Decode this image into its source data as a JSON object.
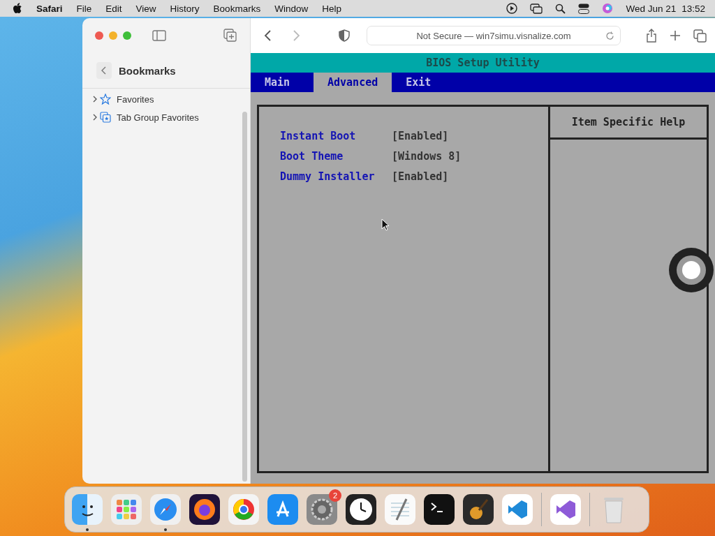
{
  "menu_bar": {
    "app": "Safari",
    "items": [
      "File",
      "Edit",
      "View",
      "History",
      "Bookmarks",
      "Window",
      "Help"
    ],
    "date": "Wed Jun 21",
    "time": "13:52"
  },
  "sidebar": {
    "title": "Bookmarks",
    "items": [
      {
        "label": "Favorites",
        "kind": "star",
        "expanded": false
      },
      {
        "label": "Tab Group Favorites",
        "kind": "tabgroup",
        "expanded": false
      }
    ]
  },
  "address_bar": {
    "text": "Not Secure — win7simu.visnalize.com"
  },
  "bios": {
    "title": "BIOS Setup Utility",
    "tabs": [
      {
        "label": "Main",
        "selected": false
      },
      {
        "label": "Advanced",
        "selected": true
      },
      {
        "label": "Exit",
        "selected": false
      }
    ],
    "settings": [
      {
        "label": "Instant Boot",
        "value": "[Enabled]"
      },
      {
        "label": "Boot Theme",
        "value": "[Windows 8]"
      },
      {
        "label": "Dummy Installer",
        "value": "[Enabled]"
      }
    ],
    "help_title": "Item Specific Help"
  },
  "dock": [
    {
      "kind": "finder",
      "running": true
    },
    {
      "kind": "launchpad",
      "running": false
    },
    {
      "kind": "safari",
      "running": true
    },
    {
      "kind": "firefox",
      "running": false
    },
    {
      "kind": "chrome",
      "running": false
    },
    {
      "kind": "appstore",
      "running": false
    },
    {
      "kind": "settings",
      "running": false,
      "badge": "2"
    },
    {
      "kind": "clock",
      "running": false
    },
    {
      "kind": "textedit",
      "running": false
    },
    {
      "kind": "terminal",
      "running": false
    },
    {
      "kind": "garageband",
      "running": false
    },
    {
      "kind": "vscode",
      "running": false
    },
    {
      "kind": "separator"
    },
    {
      "kind": "visualstudio",
      "running": false
    },
    {
      "kind": "separator"
    },
    {
      "kind": "trash",
      "running": false
    }
  ]
}
